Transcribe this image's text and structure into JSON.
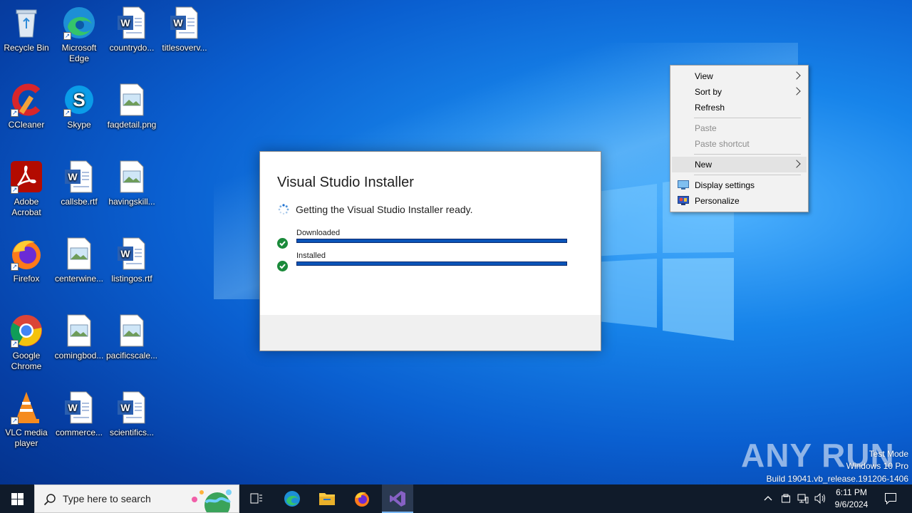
{
  "desktop": {
    "icons": [
      {
        "label": "Recycle Bin"
      },
      {
        "label": "Microsoft Edge"
      },
      {
        "label": "countrydo..."
      },
      {
        "label": "titlesoverv..."
      },
      {
        "label": "CCleaner"
      },
      {
        "label": "Skype"
      },
      {
        "label": "faqdetail.png"
      },
      {
        "label": "Adobe Acrobat"
      },
      {
        "label": "callsbe.rtf"
      },
      {
        "label": "havingskill..."
      },
      {
        "label": "Firefox"
      },
      {
        "label": "centerwine..."
      },
      {
        "label": "listingos.rtf"
      },
      {
        "label": "Google Chrome"
      },
      {
        "label": "comingbod..."
      },
      {
        "label": "pacificscale..."
      },
      {
        "label": "VLC media player"
      },
      {
        "label": "commerce..."
      },
      {
        "label": "scientifics..."
      }
    ]
  },
  "dialog": {
    "title": "Visual Studio Installer",
    "status": "Getting the Visual Studio Installer ready.",
    "steps": [
      {
        "label": "Downloaded",
        "progress": 1.0
      },
      {
        "label": "Installed",
        "progress": 1.0
      }
    ]
  },
  "context_menu": {
    "items": [
      {
        "label": "View",
        "submenu": true,
        "disabled": false
      },
      {
        "label": "Sort by",
        "submenu": true,
        "disabled": false
      },
      {
        "label": "Refresh",
        "submenu": false,
        "disabled": false
      },
      {
        "label": "Paste",
        "submenu": false,
        "disabled": true
      },
      {
        "label": "Paste shortcut",
        "submenu": false,
        "disabled": true
      },
      {
        "label": "New",
        "submenu": true,
        "disabled": false,
        "highlighted": true
      },
      {
        "label": "Display settings",
        "submenu": false,
        "disabled": false,
        "icon": "display-icon"
      },
      {
        "label": "Personalize",
        "submenu": false,
        "disabled": false,
        "icon": "personalize-icon"
      }
    ]
  },
  "watermark": {
    "brand": "ANY RUN",
    "line1": "Test Mode",
    "line2": "Windows 10 Pro",
    "line3": "Build 19041.vb_release.191206-1406"
  },
  "taskbar": {
    "search_placeholder": "Type here to search",
    "time": "6:11 PM",
    "date": "9/6/2024"
  },
  "colors": {
    "accent": "#0a54b8",
    "success": "#1a8a3a",
    "taskbar": "#101b2a"
  }
}
